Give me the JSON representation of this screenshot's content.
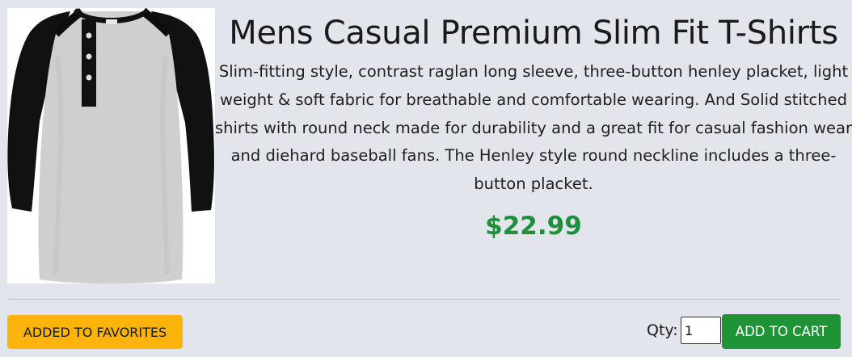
{
  "product": {
    "title": "Mens Casual Premium Slim Fit T-Shirts",
    "description": "Slim-fitting style, contrast raglan long sleeve, three-button henley placket, light weight & soft fabric for breathable and comfortable wearing. And Solid stitched shirts with round neck made for durability and a great fit for casual fashion wear and diehard baseball fans. The Henley style round neckline includes a three-button placket.",
    "price": "$22.99",
    "image_icon": "henley-shirt-image"
  },
  "actions": {
    "favorites_label": "ADDED TO FAVORITES",
    "qty_label": "Qty:",
    "qty_value": "1",
    "cart_label": "ADD TO CART"
  },
  "colors": {
    "background": "#e2e5eb",
    "price": "#1e8f3a",
    "favorites_button": "#fcb30b",
    "cart_button": "#1e9437"
  }
}
